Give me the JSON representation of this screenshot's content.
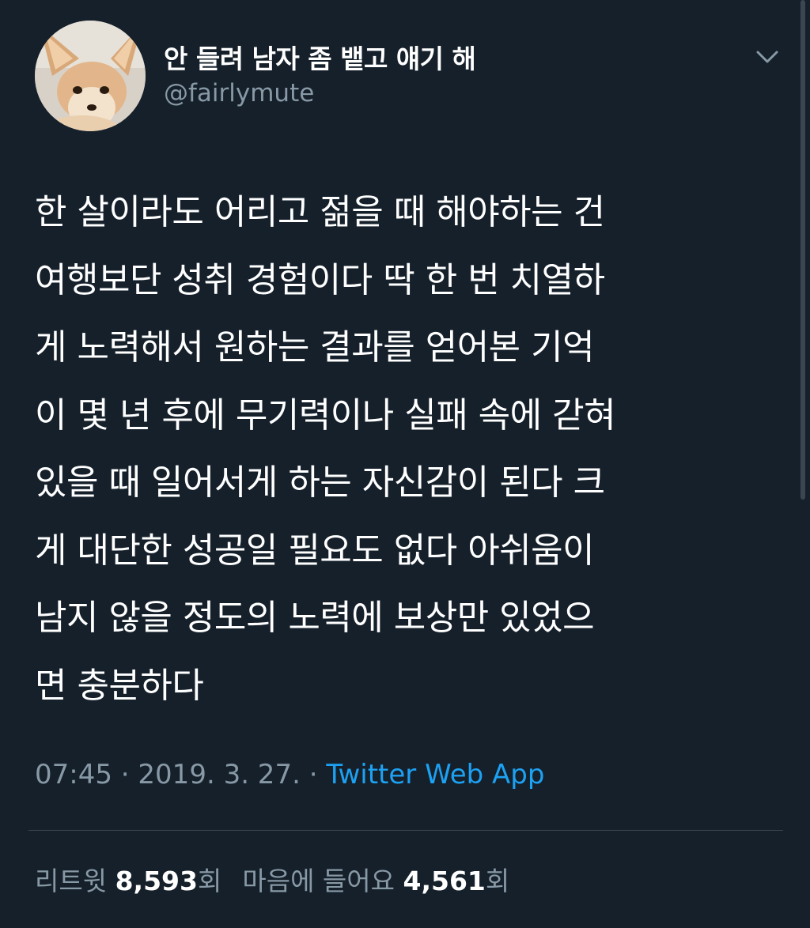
{
  "user": {
    "display_name": "안 들려 남자 좀 뱉고 얘기 해",
    "handle": "@fairlymute",
    "avatar_icon": "fennec-fox-avatar"
  },
  "menu": {
    "icon": "chevron-down-icon"
  },
  "tweet": {
    "lines": [
      "한 살이라도 어리고 젊을 때 해야하는 건",
      "여행보단 성취 경험이다 딱 한 번 치열하",
      "게 노력해서 원하는 결과를 얻어본 기억",
      "이 몇 년 후에 무기력이나 실패 속에 갇혀",
      "있을 때 일어서게 하는 자신감이 된다 크",
      "게 대단한 성공일 필요도 없다 아쉬움이",
      "남지 않을 정도의 노력에 보상만 있었으",
      "면 충분하다"
    ]
  },
  "meta": {
    "time": "07:45",
    "separator": "·",
    "date": "2019. 3. 27.",
    "source": "Twitter Web App"
  },
  "stats": {
    "retweet_label": "리트윗",
    "retweet_count": "8,593",
    "retweet_unit": "회",
    "like_label": "마음에 들어요",
    "like_count": "4,561",
    "like_unit": "회"
  },
  "colors": {
    "background": "#15202b",
    "text": "#ffffff",
    "secondary": "#8899a6",
    "link": "#1da1f2",
    "divider": "#38444d"
  }
}
